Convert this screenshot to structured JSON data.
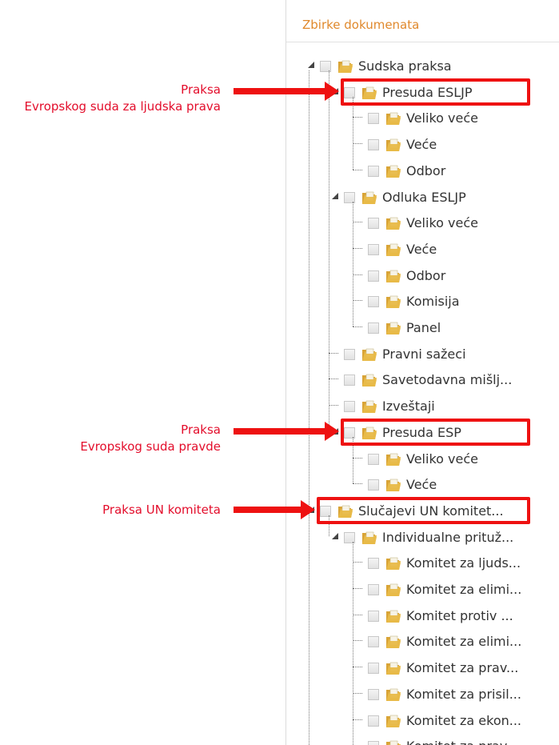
{
  "panel": {
    "title": "Zbirke dokumenata"
  },
  "colors": {
    "title": "#e0892d",
    "annotation": "#e30d2b",
    "highlight": "#ee1111",
    "folder": "#e8b948"
  },
  "tree": [
    {
      "label": "Sudska praksa",
      "depth": 0,
      "expanded": true
    },
    {
      "label": "Presuda ESLJP",
      "depth": 1,
      "expanded": true
    },
    {
      "label": "Veliko veće",
      "depth": 2
    },
    {
      "label": "Veće",
      "depth": 2
    },
    {
      "label": "Odbor",
      "depth": 2
    },
    {
      "label": "Odluka ESLJP",
      "depth": 1,
      "expanded": true
    },
    {
      "label": "Veliko veće",
      "depth": 2
    },
    {
      "label": "Veće",
      "depth": 2
    },
    {
      "label": "Odbor",
      "depth": 2
    },
    {
      "label": "Komisija",
      "depth": 2
    },
    {
      "label": "Panel",
      "depth": 2
    },
    {
      "label": "Pravni sažeci",
      "depth": 1
    },
    {
      "label": "Savetodavna mišlj...",
      "depth": 1
    },
    {
      "label": "Izveštaji",
      "depth": 1
    },
    {
      "label": "Presuda ESP",
      "depth": 1,
      "expanded": true
    },
    {
      "label": "Veliko veće",
      "depth": 2
    },
    {
      "label": "Veće",
      "depth": 2
    },
    {
      "label": "Slučajevi UN komitet...",
      "depth": 0,
      "expanded": true
    },
    {
      "label": "Individualne prituž...",
      "depth": 1,
      "expanded": true
    },
    {
      "label": "Komitet za ljuds...",
      "depth": 2
    },
    {
      "label": "Komitet za elimi...",
      "depth": 2
    },
    {
      "label": "Komitet protiv ...",
      "depth": 2
    },
    {
      "label": "Komitet za elimi...",
      "depth": 2
    },
    {
      "label": "Komitet za prav...",
      "depth": 2
    },
    {
      "label": "Komitet za prisil...",
      "depth": 2
    },
    {
      "label": "Komitet za ekon...",
      "depth": 2
    },
    {
      "label": "Komitet za prav...",
      "depth": 2
    }
  ],
  "annotations": [
    {
      "text": "Praksa\nEvropskog suda za ljudska prava",
      "target": "Presuda ESLJP"
    },
    {
      "text": "Praksa\nEvropskog suda pravde",
      "target": "Presuda ESP"
    },
    {
      "text": "Praksa UN komiteta",
      "target": "Slučajevi UN komitet..."
    }
  ]
}
